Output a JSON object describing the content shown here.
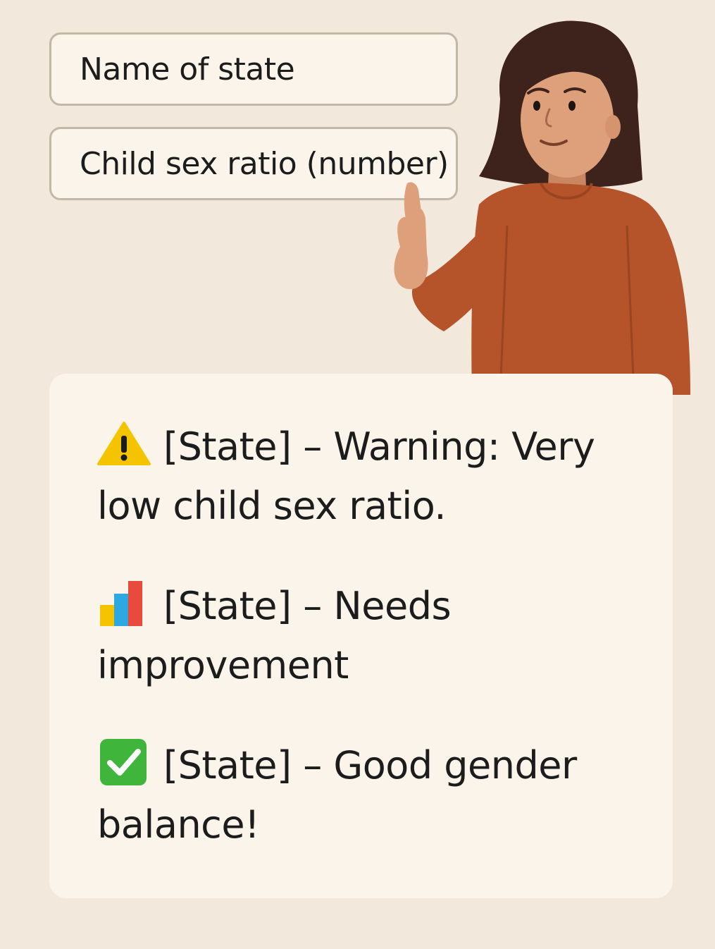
{
  "form": {
    "state_field": {
      "placeholder": "Name of state"
    },
    "ratio_field": {
      "placeholder": "Child sex ratio (number)"
    }
  },
  "results": [
    {
      "icon": "warning-icon",
      "text": "[State] – Warning: Very low child sex ratio.",
      "color": "#f5c400"
    },
    {
      "icon": "bar-chart-icon",
      "text": "[State] – Needs improvement",
      "color": "#e84b3c"
    },
    {
      "icon": "check-mark-icon",
      "text": "[State] – Good gender balance!",
      "color": "#3fb53b"
    }
  ]
}
